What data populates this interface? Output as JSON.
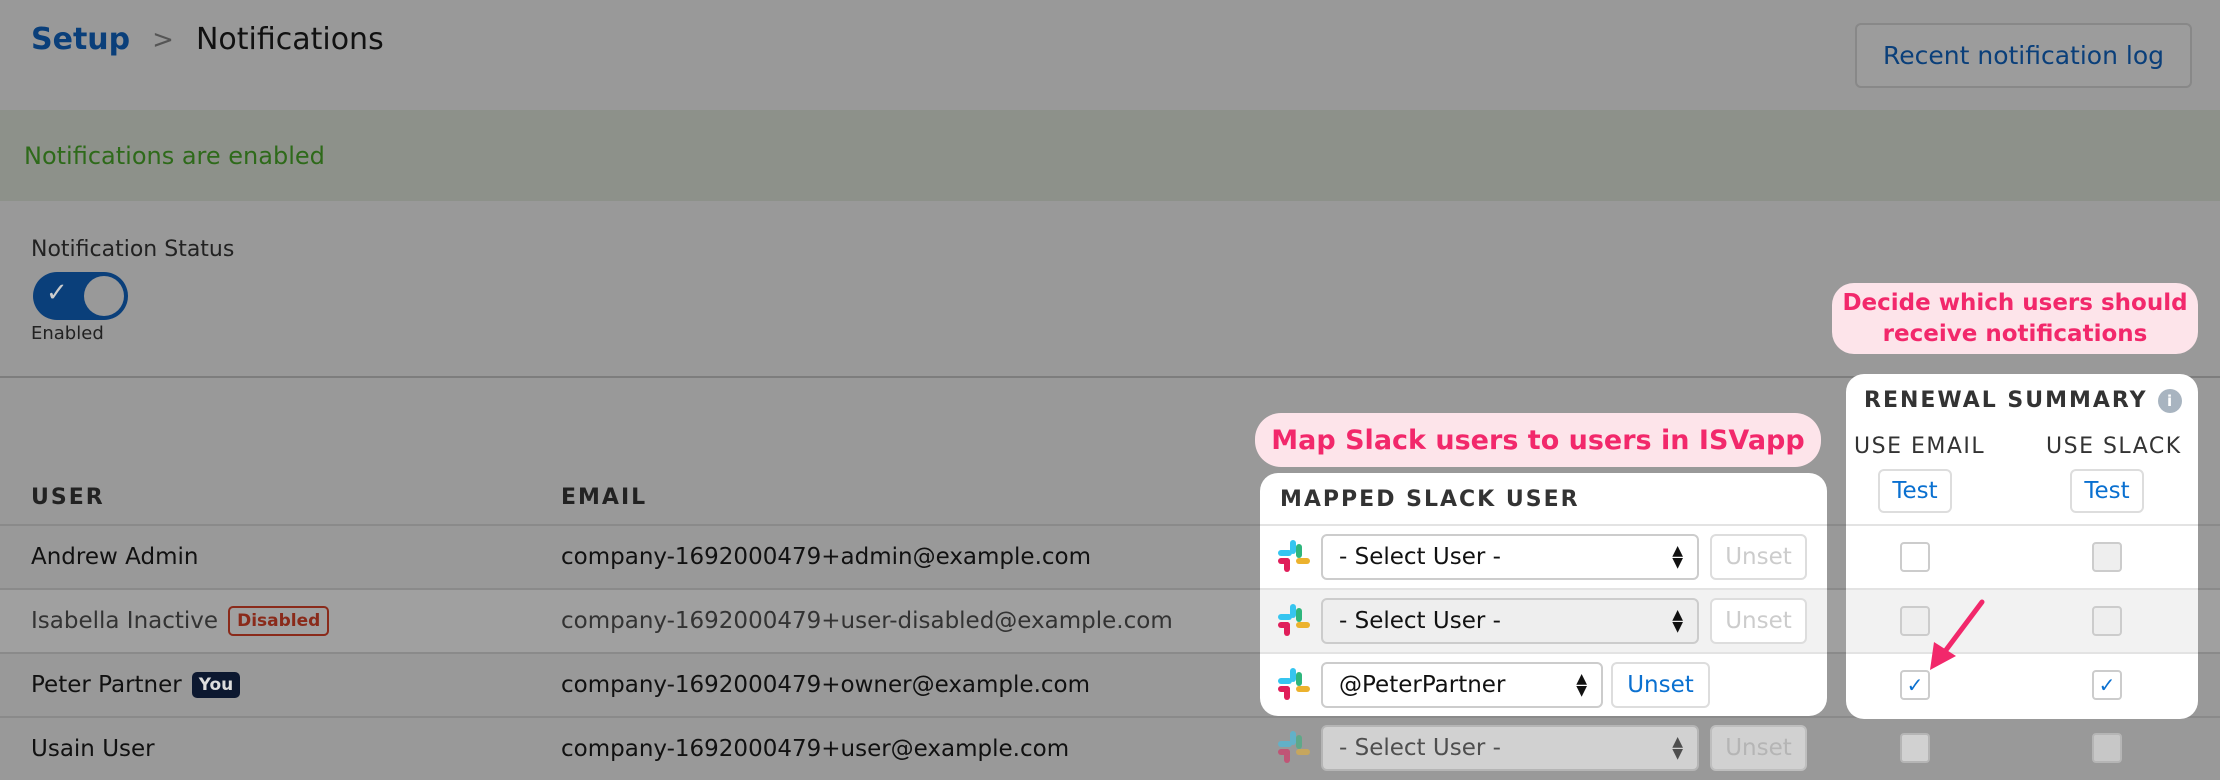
{
  "breadcrumb": {
    "root": "Setup",
    "separator": ">",
    "current": "Notifications"
  },
  "header": {
    "log_button": "Recent notification log"
  },
  "banner": {
    "text": "Notifications are enabled"
  },
  "status": {
    "label": "Notification Status",
    "toggle_state": "Enabled",
    "enabled": true
  },
  "table": {
    "headers": {
      "user": "USER",
      "email": "EMAIL",
      "mapped": "MAPPED SLACK USER",
      "renewal": "RENEWAL SUMMARY",
      "use_email": "USE EMAIL",
      "use_slack": "USE SLACK",
      "test": "Test"
    },
    "rows": [
      {
        "user": "Andrew Admin",
        "badge": "",
        "email": "company-1692000479+admin@example.com",
        "slack": "- Select User -",
        "unset": "Unset",
        "email_checked": false,
        "slack_checked": false
      },
      {
        "user": "Isabella Inactive",
        "badge": "Disabled",
        "email": "company-1692000479+user-disabled@example.com",
        "slack": "- Select User -",
        "unset": "Unset",
        "email_checked": false,
        "slack_checked": false
      },
      {
        "user": "Peter Partner",
        "badge": "You",
        "email": "company-1692000479+owner@example.com",
        "slack": "@PeterPartner",
        "unset": "Unset",
        "email_checked": true,
        "slack_checked": true
      },
      {
        "user": "Usain User",
        "badge": "",
        "email": "company-1692000479+user@example.com",
        "slack": "- Select User -",
        "unset": "Unset",
        "email_checked": false,
        "slack_checked": false
      }
    ]
  },
  "annotations": {
    "slack": "Map Slack users to users in ISVapp",
    "renewal": "Decide which users should receive notifications"
  },
  "colors": {
    "accent": "#0a70d0",
    "annotation": "#f2286b",
    "brand_dark": "#0a3f7a"
  }
}
